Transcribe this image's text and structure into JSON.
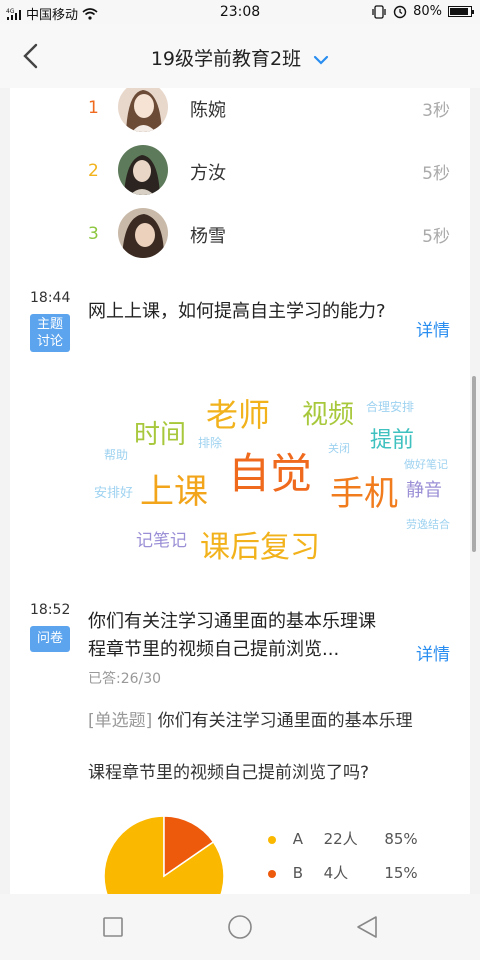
{
  "status_bar": {
    "network": "4G",
    "carrier": "中国移动",
    "time": "23:08",
    "battery": "80%",
    "battery_level": 0.8
  },
  "nav": {
    "title": "19级学前教育2班",
    "back_icon": "back-chevron-icon",
    "dropdown_icon": "chevron-down-icon"
  },
  "ranking": [
    {
      "rank": "1",
      "name": "陈婉",
      "time": "3秒",
      "color": "#f06a1e"
    },
    {
      "rank": "2",
      "name": "方汝",
      "time": "5秒",
      "color": "#f2b21b"
    },
    {
      "rank": "3",
      "name": "杨雪",
      "time": "5秒",
      "color": "#8cc63f"
    }
  ],
  "discussion": {
    "time": "18:44",
    "tag": "主题讨论",
    "tag_line1": "主题",
    "tag_line2": "讨论",
    "title": "网上上课，如何提高自主学习的能力?",
    "detail": "详情",
    "word_cloud": [
      {
        "word": "老师",
        "color": "#f2b21b"
      },
      {
        "word": "视频",
        "color": "#a8c83c"
      },
      {
        "word": "合理安排",
        "color": "#9ed2f0"
      },
      {
        "word": "时间",
        "color": "#a8c83c"
      },
      {
        "word": "排除",
        "color": "#9ed2f0"
      },
      {
        "word": "提前",
        "color": "#3fc1c0"
      },
      {
        "word": "帮助",
        "color": "#9ed2f0"
      },
      {
        "word": "关闭",
        "color": "#9ed2f0"
      },
      {
        "word": "自觉",
        "color": "#f06a1e"
      },
      {
        "word": "做好笔记",
        "color": "#9ed2f0"
      },
      {
        "word": "安排好",
        "color": "#9ed2f0"
      },
      {
        "word": "上课",
        "color": "#f2a51b"
      },
      {
        "word": "手机",
        "color": "#f07c1e"
      },
      {
        "word": "静音",
        "color": "#9b8fd6"
      },
      {
        "word": "劳逸结合",
        "color": "#9ed2f0"
      },
      {
        "word": "记笔记",
        "color": "#9b8fd6"
      },
      {
        "word": "课后复习",
        "color": "#f2b21b"
      }
    ]
  },
  "survey": {
    "time": "18:52",
    "tag": "问卷",
    "title": "你们有关注学习通里面的基本乐理课程章节里的视频自己提前浏览...",
    "detail": "详情",
    "answered": "已答:26/30",
    "question_type": "[单选题]",
    "question_line1": "你们有关注学习通里面的基本乐理",
    "question_line2": "课程章节里的视频自己提前浏览了吗?",
    "chart_data": {
      "type": "pie",
      "categories": [
        "A",
        "B"
      ],
      "values": [
        22,
        4
      ],
      "percents": [
        "85%",
        "15%"
      ],
      "counts": [
        "22人",
        "4人"
      ],
      "colors": [
        "#fbb800",
        "#ee5a0c"
      ]
    }
  },
  "bottom_nav": {
    "recent_icon": "square-icon",
    "home_icon": "circle-icon",
    "back_icon": "triangle-back-icon"
  }
}
